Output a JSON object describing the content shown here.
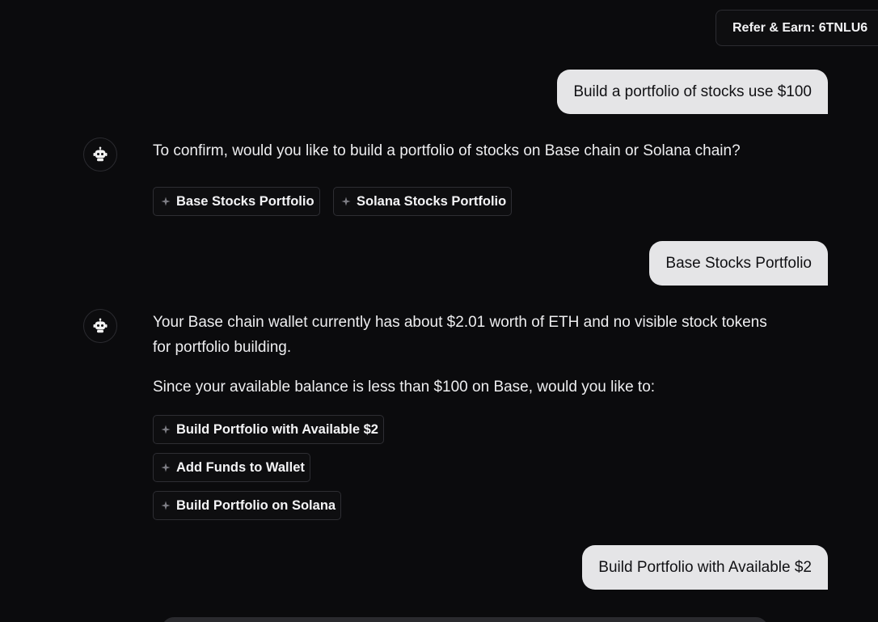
{
  "header": {
    "refer_label": "Refer & Earn: 6TNLU6"
  },
  "conversation": {
    "user_message_1": "Build a portfolio of stocks use $100",
    "assistant_message_1": "To confirm, would you like to build a portfolio of stocks on Base chain or Solana chain?",
    "suggestions_1": [
      "Base Stocks Portfolio",
      "Solana Stocks Portfolio"
    ],
    "user_message_2": "Base Stocks Portfolio",
    "assistant_message_2_p1": "Your Base chain wallet currently has about $2.01 worth of ETH and no visible stock tokens for portfolio building.",
    "assistant_message_2_p2": "Since your available balance is less than $100 on Base, would you like to:",
    "suggestions_2": [
      "Build Portfolio with Available $2",
      "Add Funds to Wallet",
      "Build Portfolio on Solana"
    ],
    "user_message_3": "Build Portfolio with Available $2"
  },
  "icons": {
    "assistant_avatar": "robot-icon",
    "suggestion": "sparkle-icon"
  },
  "colors": {
    "background": "#0b0b0d",
    "user_bubble": "#e5e5e7",
    "chip_border": "#2e2e33"
  }
}
